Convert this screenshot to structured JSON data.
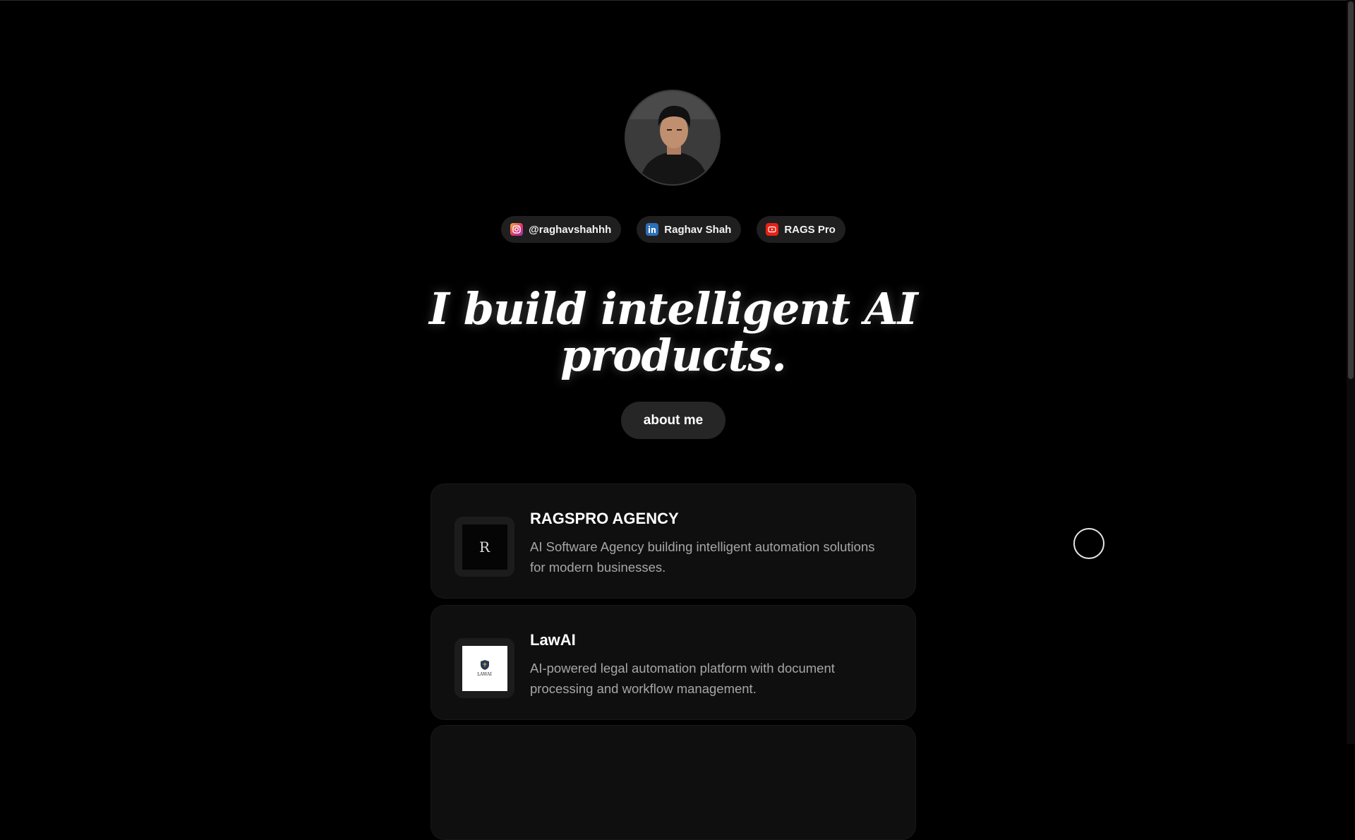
{
  "profile": {
    "avatar_icon": "person-avatar"
  },
  "socials": [
    {
      "icon": "instagram-icon",
      "label": "@raghavshahhh"
    },
    {
      "icon": "linkedin-icon",
      "label": "Raghav Shah"
    },
    {
      "icon": "youtube-icon",
      "label": "RAGS Pro"
    }
  ],
  "hero": {
    "line1": "I build intelligent AI",
    "line2": "products."
  },
  "about_button": "about me",
  "projects": [
    {
      "name": "RAGSPRO AGENCY",
      "description": "AI Software Agency building intelligent automation solutions for modern businesses.",
      "logo_text": "R"
    },
    {
      "name": "LawAI",
      "description": "AI-powered legal automation platform with document processing and workflow management.",
      "logo_text": "LAWAI"
    }
  ],
  "colors": {
    "background": "#000000",
    "card": "#0f0f0f",
    "pill": "#1f1f1f",
    "muted_text": "#a6a6a6"
  }
}
